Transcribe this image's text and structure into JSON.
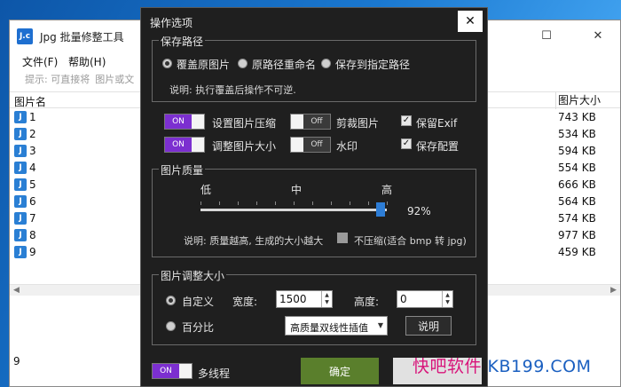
{
  "main_window": {
    "title": "Jpg 批量修整工具",
    "app_icon_text": "J.c",
    "menu": [
      "文件(F)",
      "帮助(H)"
    ],
    "hint": "提示: 可直接将",
    "hint_tail": "图片或文",
    "columns": {
      "name": "图片名",
      "size": "图片大小"
    },
    "files": [
      {
        "name": "1",
        "size": "743 KB"
      },
      {
        "name": "2",
        "size": "534 KB"
      },
      {
        "name": "3",
        "size": "594 KB"
      },
      {
        "name": "4",
        "size": "554 KB"
      },
      {
        "name": "5",
        "size": "666 KB"
      },
      {
        "name": "6",
        "size": "564 KB"
      },
      {
        "name": "7",
        "size": "574 KB"
      },
      {
        "name": "8",
        "size": "977 KB"
      },
      {
        "name": "9",
        "size": "459 KB"
      }
    ],
    "status_count": "9"
  },
  "dialog": {
    "title": "操作选项",
    "save_path": {
      "group_title": "保存路径",
      "options": [
        "覆盖原图片",
        "原路径重命名",
        "保存到指定路径"
      ],
      "selected_index": 0,
      "note": "说明: 执行覆盖后操作不可逆."
    },
    "options": {
      "compress": {
        "label": "设置图片压缩",
        "state": "ON"
      },
      "crop": {
        "label": "剪裁图片",
        "state": "Off"
      },
      "keep_exif": {
        "label": "保留Exif",
        "checked": true
      },
      "resize": {
        "label": "调整图片大小",
        "state": "ON"
      },
      "watermark": {
        "label": "水印",
        "state": "Off"
      },
      "save_config": {
        "label": "保存配置",
        "checked": true
      }
    },
    "quality": {
      "group_title": "图片质量",
      "low": "低",
      "mid": "中",
      "high": "高",
      "value": 92,
      "value_text": "92%",
      "note": "说明: 质量越高, 生成的大小越大",
      "no_compress_label": "不压缩(适合 bmp 转 jpg)",
      "no_compress_checked": false
    },
    "resize": {
      "group_title": "图片调整大小",
      "custom_label": "自定义",
      "percent_label": "百分比",
      "selected": "custom",
      "width_label": "宽度:",
      "width_value": "1500",
      "height_label": "高度:",
      "height_value": "0",
      "interpolation": "高质量双线性插值",
      "help_button": "说明"
    },
    "multithread": {
      "label": "多线程",
      "state": "ON"
    },
    "ok_button": "确定",
    "cancel_button": ""
  },
  "watermark_text": {
    "part1": "快吧软件",
    "part2": " KB199.COM"
  },
  "colors": {
    "toggle_on": "#7c2fd0",
    "ok_button": "#5a7f2c",
    "slider_thumb": "#2d7dd6"
  }
}
